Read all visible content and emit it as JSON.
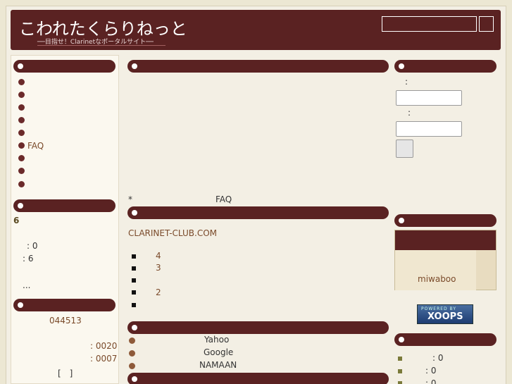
{
  "header": {
    "site_title": "こわれたくらりねっと",
    "site_subtitle": "──目指せ！Clarinetなポータルサイト──",
    "search_button_label": ""
  },
  "left": {
    "menu_items": [
      "",
      "",
      "",
      "",
      "",
      "FAQ",
      "",
      "",
      ""
    ],
    "block2": {
      "count": "6",
      "line1": ": 0",
      "line2": ": 6",
      "more": "..."
    },
    "block3": {
      "number": "044513",
      "line1": ": 0020",
      "line2": ": 0007",
      "bracket": "[　]"
    }
  },
  "center": {
    "faq_star": "*",
    "faq_label": "FAQ",
    "domain_link": "CLARINET-CLUB.COM",
    "list_numbers": [
      "4",
      "3",
      "",
      "2",
      ""
    ],
    "links": [
      "Yahoo",
      "Google",
      "NAMAAN"
    ]
  },
  "right": {
    "login": {
      "label1": ":",
      "label2": ":",
      "button_label": ""
    },
    "block2": {
      "user": "miwaboo"
    },
    "xoops": {
      "powered_by": "POWERED BY",
      "logo_text": "XOOPS"
    },
    "stats": [
      ": 0",
      ": 0",
      ": 0"
    ]
  }
}
